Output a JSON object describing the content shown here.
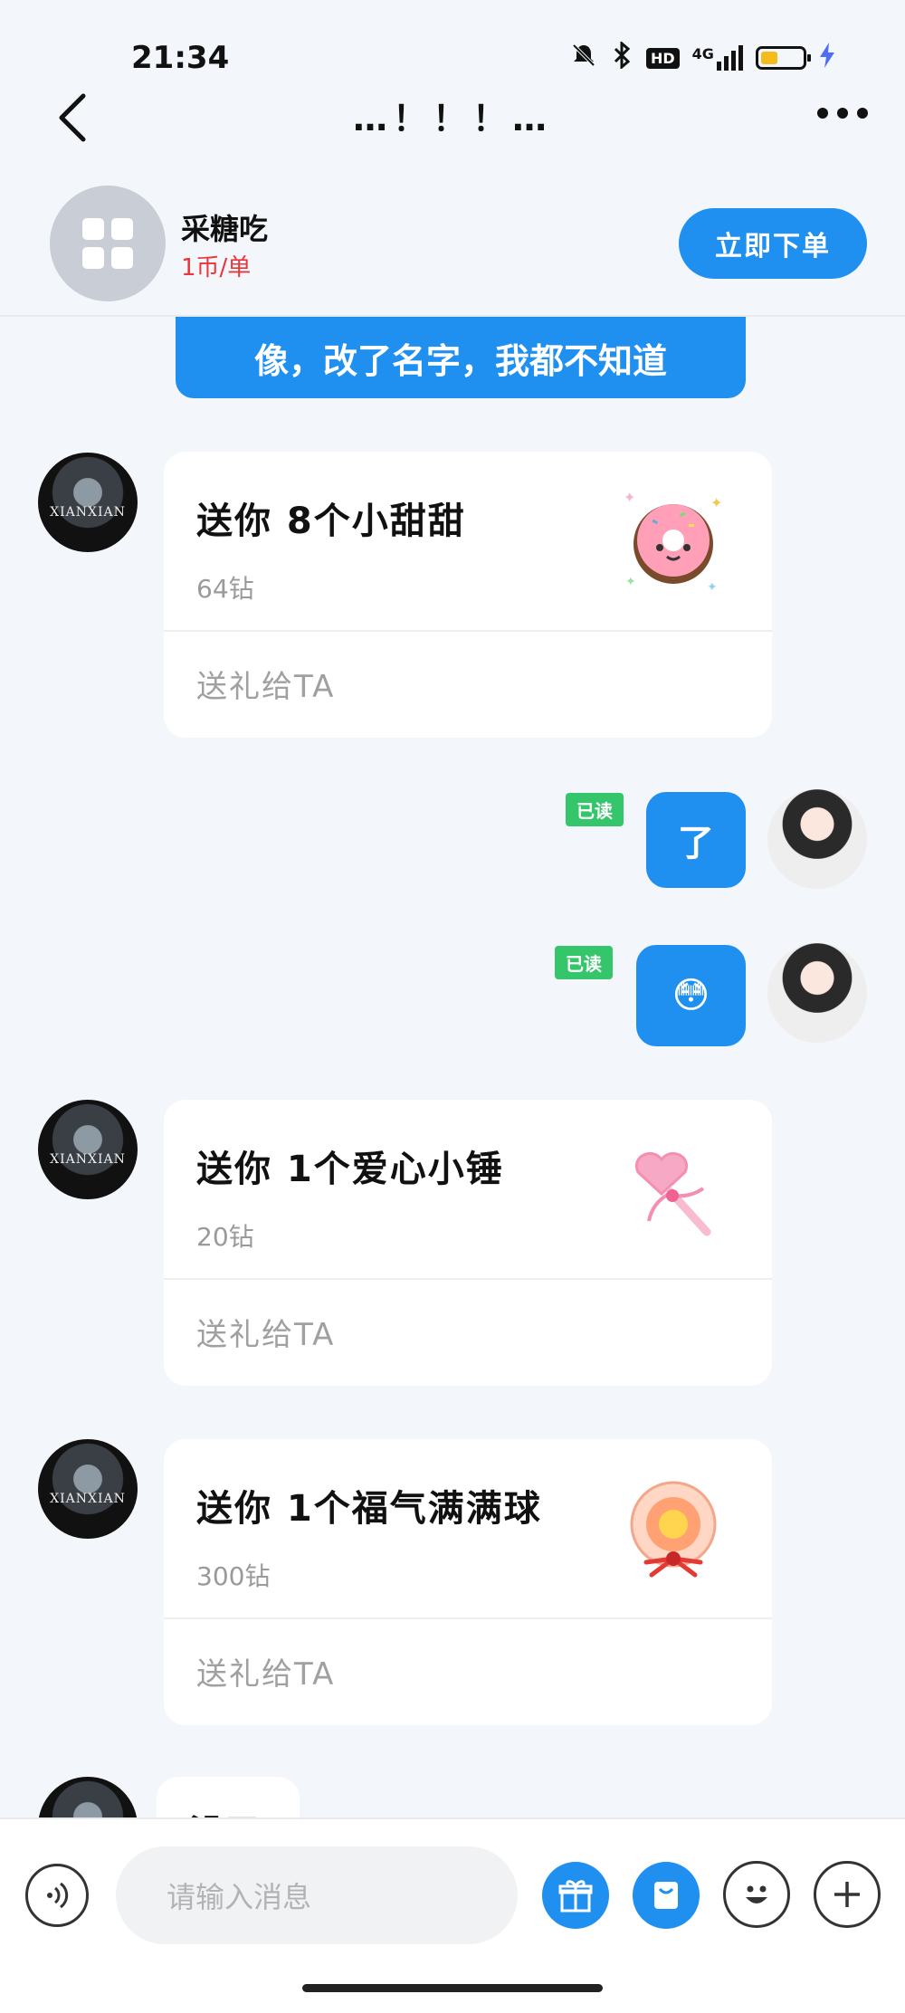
{
  "status_bar": {
    "time": "21:34",
    "network": "4G",
    "hd": "HD"
  },
  "nav": {
    "title": "…！！！…"
  },
  "shop": {
    "name": "采糖吃",
    "price": "1币/单",
    "order_button": "立即下单"
  },
  "messages": {
    "top_bubble_text": "像，改了名字，我都不知道",
    "gifts": [
      {
        "title": "送你 8个小甜甜",
        "price": "64钻",
        "action": "送礼给TA",
        "icon": "donut-icon"
      },
      {
        "title": "送你 1个爱心小锤",
        "price": "20钻",
        "action": "送礼给TA",
        "icon": "heart-hammer-icon"
      },
      {
        "title": "送你 1个福气满满球",
        "price": "300钻",
        "action": "送礼给TA",
        "icon": "fortune-ball-icon"
      }
    ],
    "my_messages": [
      {
        "text": "了",
        "read": "已读"
      },
      {
        "text": "😳",
        "read": "已读"
      }
    ],
    "partial_text": "没了",
    "avatar_watermark": "XIANXIAN"
  },
  "input": {
    "placeholder": "请输入消息"
  },
  "colors": {
    "accent": "#1f8ff0",
    "read_badge": "#35c56a",
    "price_red": "#e8363a"
  }
}
